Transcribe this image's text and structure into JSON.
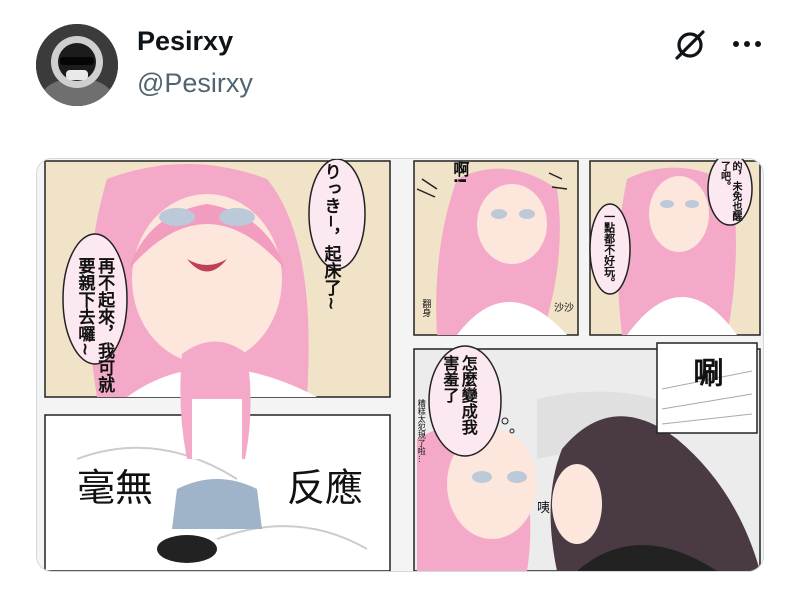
{
  "tweet": {
    "author": {
      "display_name": "Pesirxy",
      "handle": "@Pesirxy"
    },
    "actions": {
      "grok_icon": "grok-icon",
      "more_icon": "more-dots-icon"
    },
    "media": {
      "panel1": {
        "bubble_top": "りっき−，起床了~",
        "bubble_left": "再不起來，我可就要親下去囉~"
      },
      "panel2": {
        "shout": "啊!",
        "sfx": "沙沙",
        "sfx_side": "翻身"
      },
      "panel3": {
        "bubble_top": "的，未免也醒了吧。",
        "bubble": "一點都不好玩。"
      },
      "panel4": {
        "left": "毫無",
        "right": "反應"
      },
      "panel5": {
        "shout": "唰",
        "bubble": "怎麼變成我害羞了",
        "side": "糟糕太犯規了啦...",
        "sfx": "咦"
      }
    },
    "colors": {
      "hair_pink": "#f4a9c8",
      "hair_dark": "#4a3a44",
      "bubble_bg": "#fce8f0",
      "panel_bg": "#f1e3c8"
    }
  }
}
